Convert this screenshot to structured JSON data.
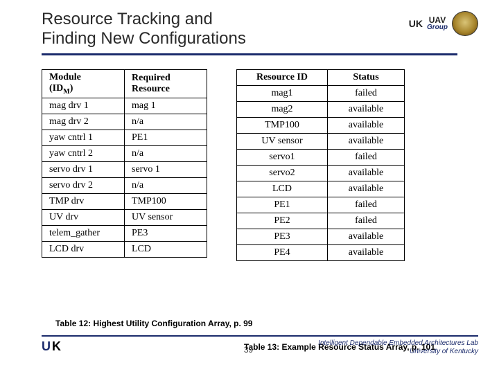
{
  "title_line1": "Resource Tracking and",
  "title_line2": "Finding New Configurations",
  "logos": {
    "uk_text": "UK",
    "uav_top": "UAV",
    "uav_bottom": "Group"
  },
  "left_table": {
    "headers": {
      "col1_a": "Module",
      "col1_b": "(ID",
      "col1_sub": "M",
      "col1_c": ")",
      "col2": "Required Resource"
    },
    "rows": [
      {
        "module": "mag drv 1",
        "res": "mag 1"
      },
      {
        "module": "mag drv 2",
        "res": "n/a"
      },
      {
        "module": "yaw cntrl 1",
        "res": "PE1"
      },
      {
        "module": "yaw cntrl 2",
        "res": "n/a"
      },
      {
        "module": "servo drv 1",
        "res": "servo 1"
      },
      {
        "module": "servo drv 2",
        "res": "n/a"
      },
      {
        "module": "TMP drv",
        "res": "TMP100"
      },
      {
        "module": "UV drv",
        "res": "UV sensor"
      },
      {
        "module": "telem_gather",
        "res": "PE3"
      },
      {
        "module": "LCD drv",
        "res": "LCD"
      }
    ]
  },
  "right_table": {
    "headers": {
      "col1": "Resource ID",
      "col2": "Status"
    },
    "rows": [
      {
        "id": "mag1",
        "status": "failed"
      },
      {
        "id": "mag2",
        "status": "available"
      },
      {
        "id": "TMP100",
        "status": "available"
      },
      {
        "id": "UV sensor",
        "status": "available"
      },
      {
        "id": "servo1",
        "status": "failed"
      },
      {
        "id": "servo2",
        "status": "available"
      },
      {
        "id": "LCD",
        "status": "available"
      },
      {
        "id": "PE1",
        "status": "failed"
      },
      {
        "id": "PE2",
        "status": "failed"
      },
      {
        "id": "PE3",
        "status": "available"
      },
      {
        "id": "PE4",
        "status": "available"
      }
    ]
  },
  "caption_12": "Table 12: Highest Utility Configuration Array, p. 99",
  "caption_13": "Table 13: Example Resource Status Array, p. 101",
  "footer": {
    "uk_u": "U",
    "uk_k": "K",
    "page": "39",
    "lab1": "Intelligent Dependable Embedded Architectures Lab",
    "lab2": "University of Kentucky"
  }
}
